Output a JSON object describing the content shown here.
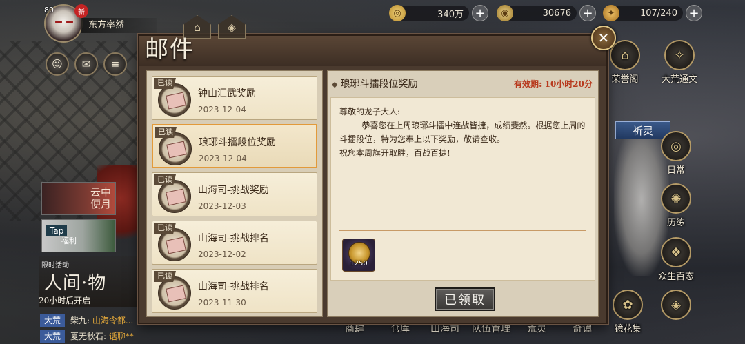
{
  "resources": [
    {
      "icon": "coin-icon",
      "value": "340万"
    },
    {
      "icon": "gem-icon",
      "value": "30676"
    },
    {
      "icon": "stamina-icon",
      "value": "107/240"
    }
  ],
  "player": {
    "level": "80",
    "new_badge": "新",
    "name": "东方率然"
  },
  "left_panel": {
    "promo1_text": "云中\n便月",
    "promo2_tap": "Tap",
    "promo2_text": "福利",
    "event_small": "限时活动",
    "event_title": "人间·物",
    "event_sub": "20小时后开启"
  },
  "chat": [
    {
      "channel": "大荒",
      "who": "柴九:",
      "msg": "山海令都..."
    },
    {
      "channel": "大荒",
      "who": "夏无秋石:",
      "msg": "话聊**"
    }
  ],
  "right_menu": {
    "honor": "荣誉阁",
    "dahuang": "大荒通文",
    "qiling": "祈灵",
    "daily": "日常",
    "training": "历练",
    "creatures": "众生百态",
    "flowers": "镜花集"
  },
  "bottom_nav": [
    "商肆",
    "仓库",
    "山海司",
    "队伍管理",
    "荒灵",
    "奇谭"
  ],
  "mail": {
    "title": "邮件",
    "items": [
      {
        "status": "已读",
        "name": "钟山汇武奖励",
        "date": "2023-12-04",
        "selected": false
      },
      {
        "status": "已读",
        "name": "琅琊斗擂段位奖励",
        "date": "2023-12-04",
        "selected": true
      },
      {
        "status": "已读",
        "name": "山海司-挑战奖励",
        "date": "2023-12-03",
        "selected": false
      },
      {
        "status": "已读",
        "name": "山海司-挑战排名",
        "date": "2023-12-02",
        "selected": false
      },
      {
        "status": "已读",
        "name": "山海司-挑战排名",
        "date": "2023-11-30",
        "selected": false
      }
    ],
    "detail": {
      "subject": "琅琊斗擂段位奖励",
      "validity": "有效期: 10小时20分",
      "greeting": "尊敬的龙子大人:",
      "para1": "恭喜您在上周琅琊斗擂中连战皆捷，成绩斐然。根据您上周的斗擂段位，特为您奉上以下奖励，敬请查收。",
      "para2": "祝您本周旗开取胜，百战百捷!",
      "reward_qty": "1250",
      "claim_label": "已领取"
    }
  }
}
